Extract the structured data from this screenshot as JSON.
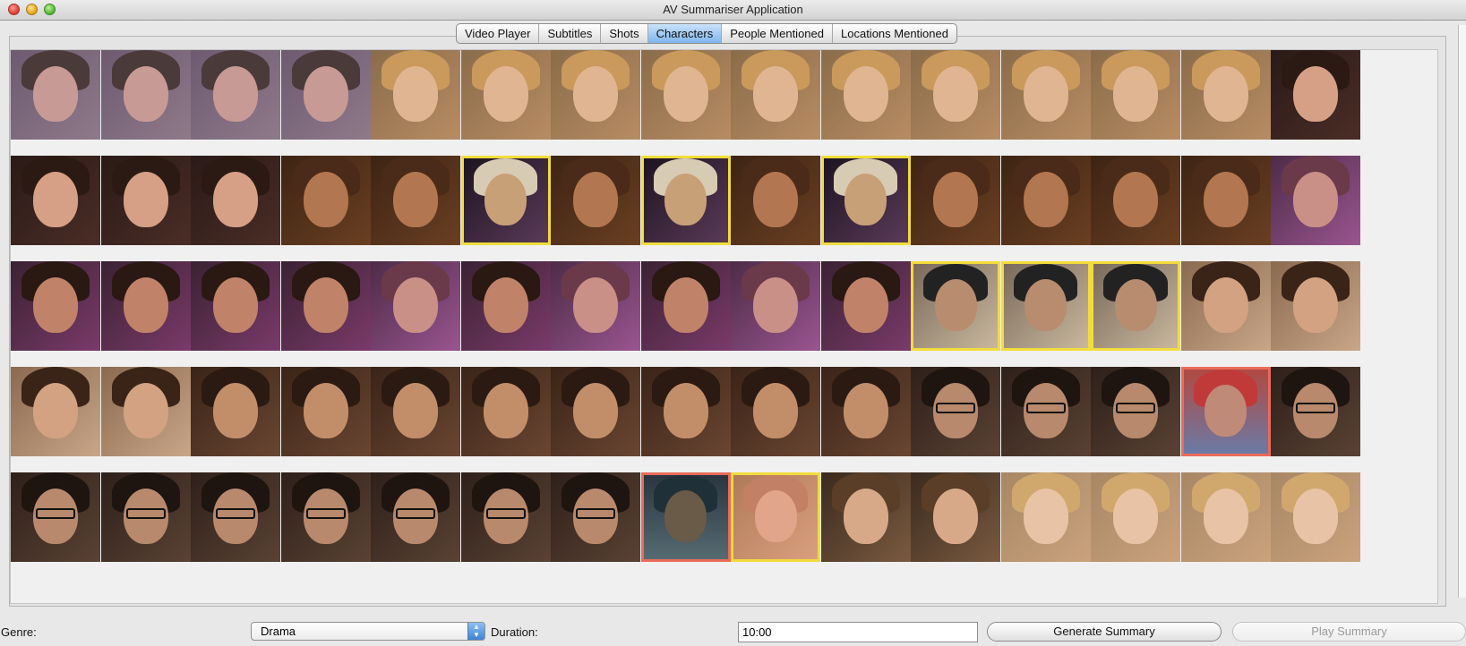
{
  "window": {
    "title": "AV Summariser Application"
  },
  "tabs": [
    {
      "label": "Video Player",
      "active": false
    },
    {
      "label": "Subtitles",
      "active": false
    },
    {
      "label": "Shots",
      "active": false
    },
    {
      "label": "Characters",
      "active": true
    },
    {
      "label": "People Mentioned",
      "active": false
    },
    {
      "label": "Locations Mentioned",
      "active": false
    }
  ],
  "grid": {
    "rows": 5,
    "cols": 15,
    "selection_colors": {
      "yellow": "#f2dc3c",
      "red": "#ea6b5a"
    },
    "thumbnails": [
      [
        {
          "kind": "boy-faded",
          "sel": ""
        },
        {
          "kind": "boy-faded",
          "sel": ""
        },
        {
          "kind": "boy-faded",
          "sel": ""
        },
        {
          "kind": "boy-faded",
          "sel": ""
        },
        {
          "kind": "blonde",
          "sel": ""
        },
        {
          "kind": "blonde",
          "sel": ""
        },
        {
          "kind": "blonde",
          "sel": ""
        },
        {
          "kind": "blonde",
          "sel": ""
        },
        {
          "kind": "blonde",
          "sel": ""
        },
        {
          "kind": "blonde",
          "sel": ""
        },
        {
          "kind": "blonde",
          "sel": ""
        },
        {
          "kind": "blonde",
          "sel": ""
        },
        {
          "kind": "blonde",
          "sel": ""
        },
        {
          "kind": "blonde",
          "sel": ""
        },
        {
          "kind": "brunette",
          "sel": ""
        }
      ],
      [
        {
          "kind": "brunette",
          "sel": ""
        },
        {
          "kind": "brunette",
          "sel": ""
        },
        {
          "kind": "brunette",
          "sel": ""
        },
        {
          "kind": "warm-girl",
          "sel": ""
        },
        {
          "kind": "warm-girl",
          "sel": ""
        },
        {
          "kind": "scene-dark",
          "sel": "yellow"
        },
        {
          "kind": "warm-girl",
          "sel": ""
        },
        {
          "kind": "scene-dark",
          "sel": "yellow"
        },
        {
          "kind": "warm-girl",
          "sel": ""
        },
        {
          "kind": "scene-dark",
          "sel": "yellow"
        },
        {
          "kind": "warm-girl",
          "sel": ""
        },
        {
          "kind": "warm-girl",
          "sel": ""
        },
        {
          "kind": "warm-girl",
          "sel": ""
        },
        {
          "kind": "warm-girl",
          "sel": ""
        },
        {
          "kind": "purple-girl",
          "sel": ""
        }
      ],
      [
        {
          "kind": "brunette-purple",
          "sel": ""
        },
        {
          "kind": "brunette-purple",
          "sel": ""
        },
        {
          "kind": "brunette-purple",
          "sel": ""
        },
        {
          "kind": "brunette-purple",
          "sel": ""
        },
        {
          "kind": "purple-girl",
          "sel": ""
        },
        {
          "kind": "brunette-purple",
          "sel": ""
        },
        {
          "kind": "purple-girl",
          "sel": ""
        },
        {
          "kind": "brunette-purple",
          "sel": ""
        },
        {
          "kind": "purple-girl",
          "sel": ""
        },
        {
          "kind": "brunette-purple",
          "sel": ""
        },
        {
          "kind": "scene-room",
          "sel": "yellow"
        },
        {
          "kind": "scene-room",
          "sel": "yellow"
        },
        {
          "kind": "scene-room",
          "sel": "yellow"
        },
        {
          "kind": "boy-light",
          "sel": ""
        },
        {
          "kind": "boy-light",
          "sel": ""
        }
      ],
      [
        {
          "kind": "boy-light",
          "sel": ""
        },
        {
          "kind": "boy-light",
          "sel": ""
        },
        {
          "kind": "boy",
          "sel": ""
        },
        {
          "kind": "boy",
          "sel": ""
        },
        {
          "kind": "boy",
          "sel": ""
        },
        {
          "kind": "boy",
          "sel": ""
        },
        {
          "kind": "boy",
          "sel": ""
        },
        {
          "kind": "boy",
          "sel": ""
        },
        {
          "kind": "boy",
          "sel": ""
        },
        {
          "kind": "boy",
          "sel": ""
        },
        {
          "kind": "glasses-boy",
          "sel": ""
        },
        {
          "kind": "glasses-boy",
          "sel": ""
        },
        {
          "kind": "glasses-boy",
          "sel": ""
        },
        {
          "kind": "neck",
          "sel": "red"
        },
        {
          "kind": "glasses-boy",
          "sel": ""
        }
      ],
      [
        {
          "kind": "glasses-boy",
          "sel": ""
        },
        {
          "kind": "glasses-boy",
          "sel": ""
        },
        {
          "kind": "glasses-boy",
          "sel": ""
        },
        {
          "kind": "glasses-boy",
          "sel": ""
        },
        {
          "kind": "glasses-boy",
          "sel": ""
        },
        {
          "kind": "glasses-boy",
          "sel": ""
        },
        {
          "kind": "glasses-boy",
          "sel": ""
        },
        {
          "kind": "window",
          "sel": "red"
        },
        {
          "kind": "mouth",
          "sel": "yellow"
        },
        {
          "kind": "teen",
          "sel": ""
        },
        {
          "kind": "teen",
          "sel": ""
        },
        {
          "kind": "blonde-light",
          "sel": ""
        },
        {
          "kind": "blonde-light",
          "sel": ""
        },
        {
          "kind": "blonde-light",
          "sel": ""
        },
        {
          "kind": "blonde-light",
          "sel": ""
        }
      ]
    ]
  },
  "controls": {
    "genre_label": "Genre:",
    "genre_value": "Drama",
    "duration_label": "Duration:",
    "duration_value": "10:00",
    "generate_button": "Generate Summary",
    "play_button": "Play Summary"
  }
}
